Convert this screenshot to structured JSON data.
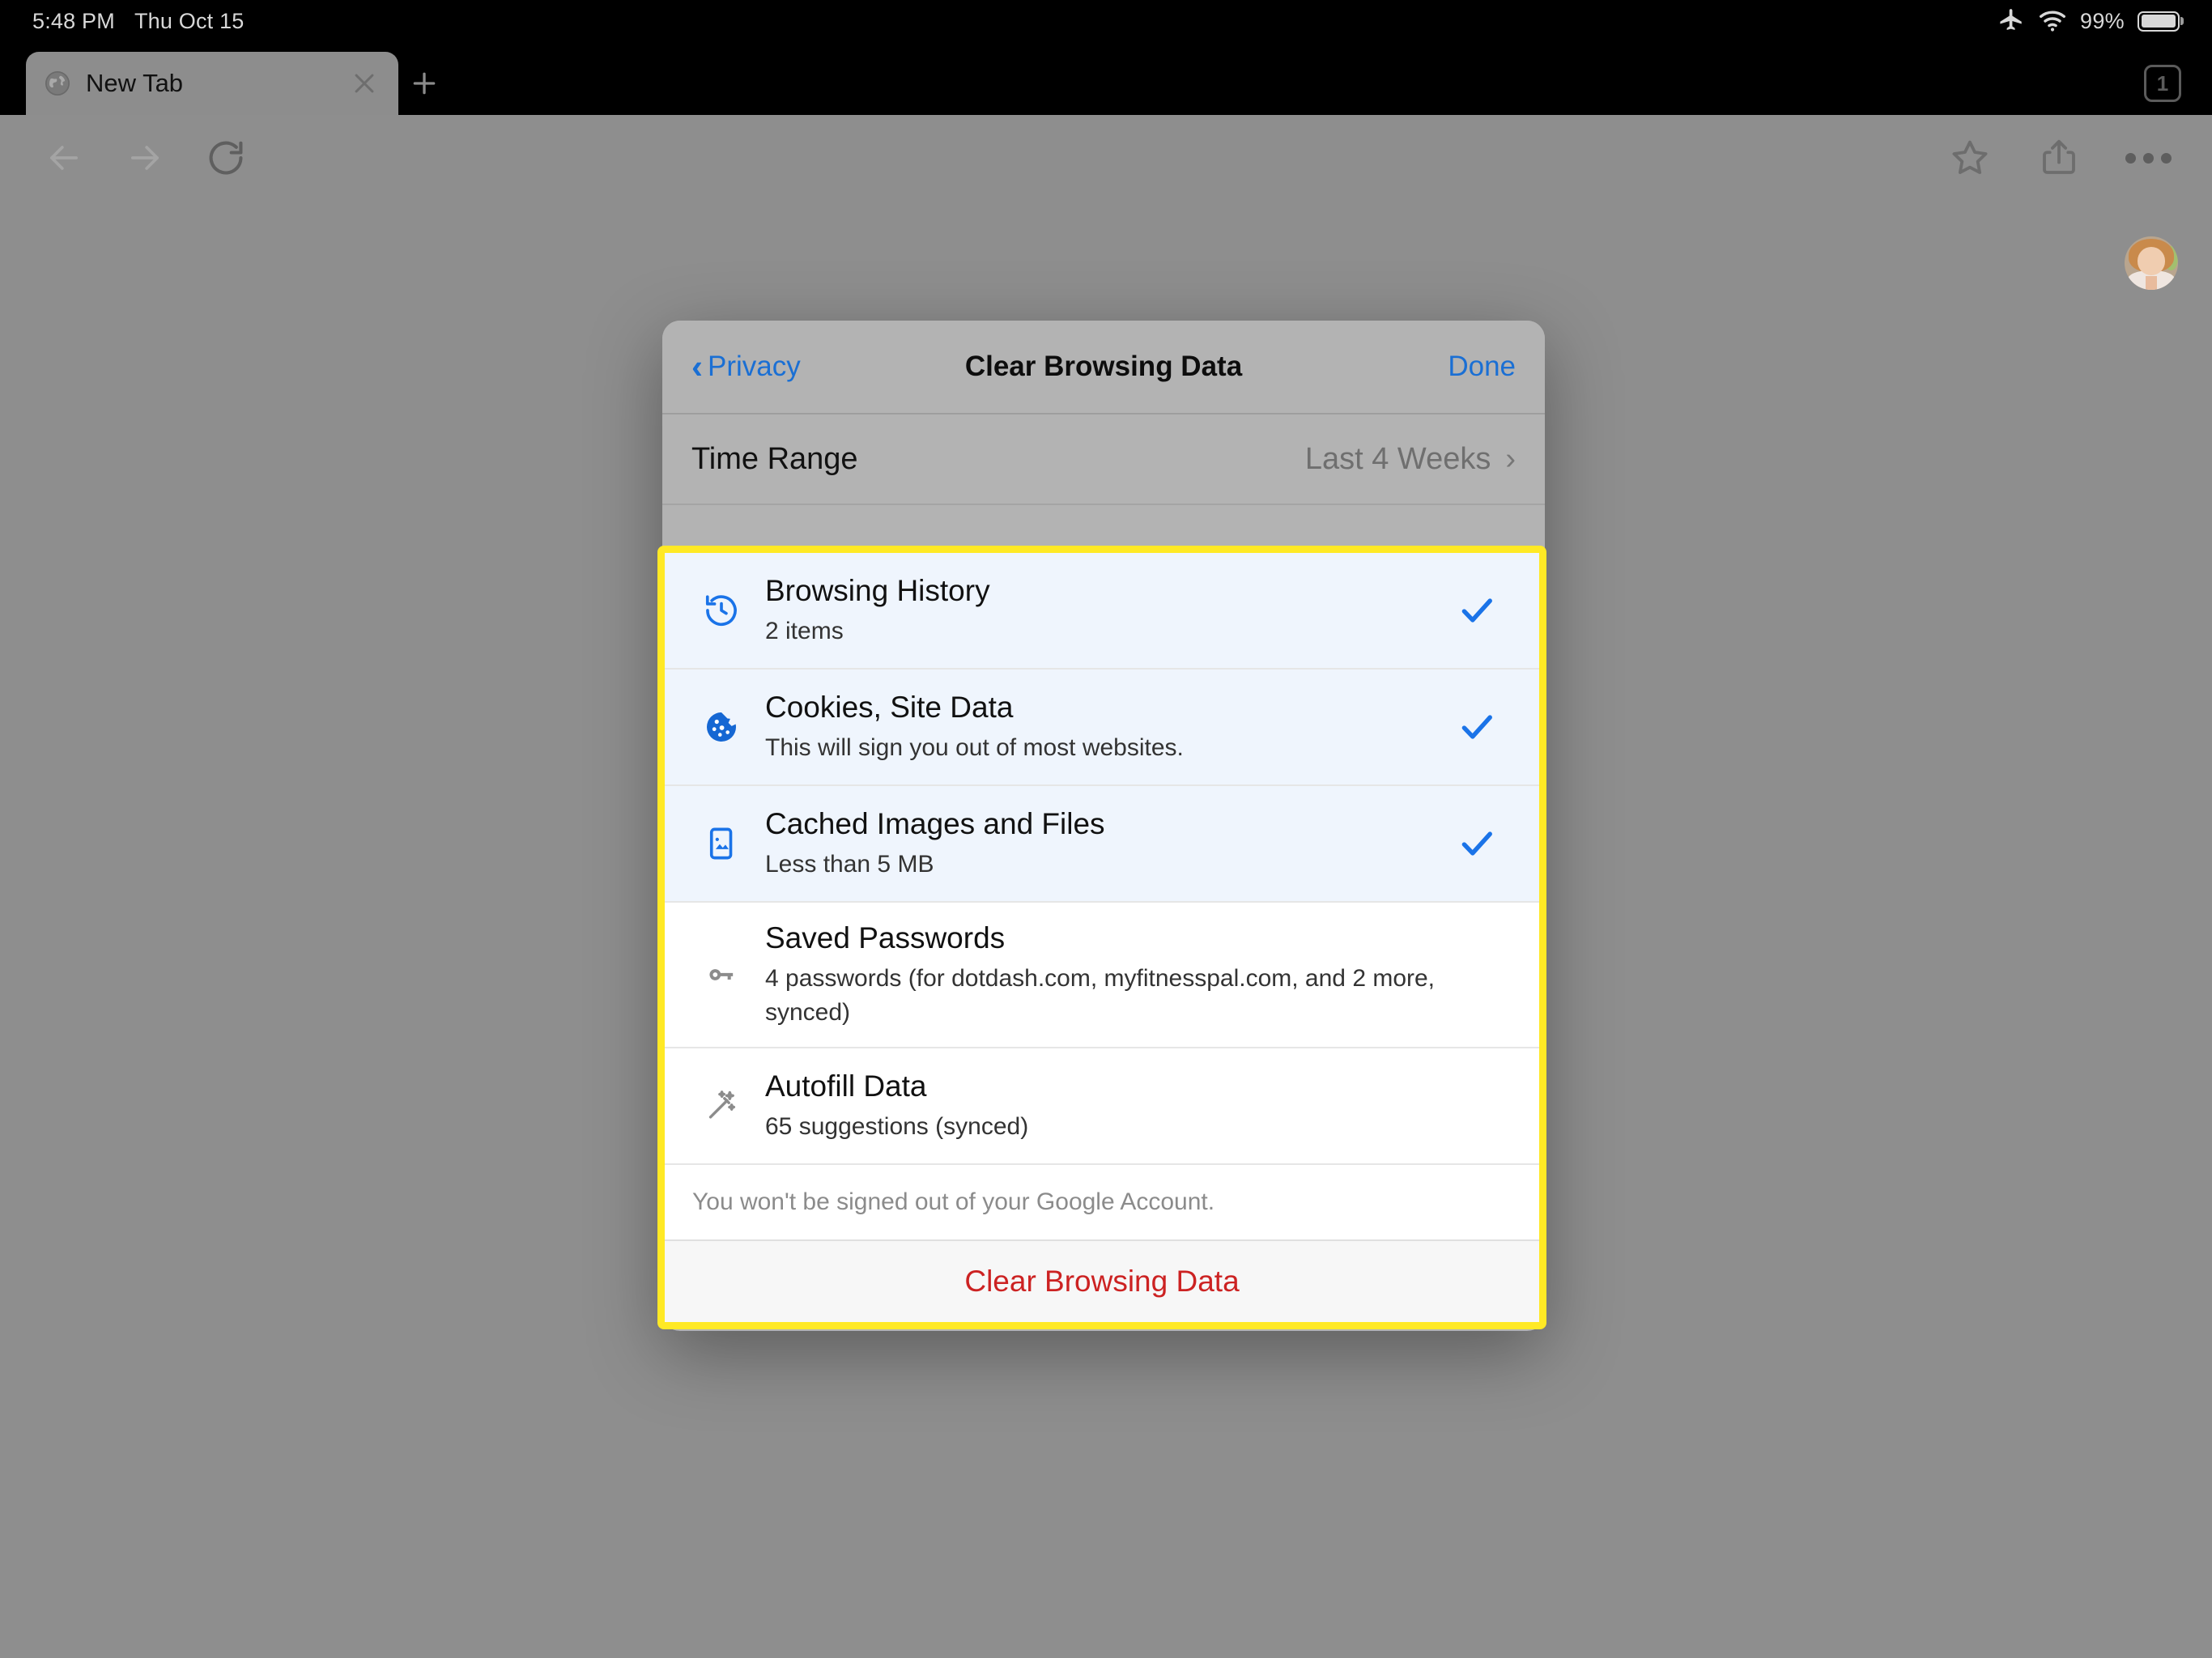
{
  "status_bar": {
    "time": "5:48 PM",
    "date": "Thu Oct 15",
    "airplane_icon": "airplane-icon",
    "wifi_icon": "wifi-icon",
    "battery_percent": "99%",
    "battery_icon": "battery-icon"
  },
  "tab_strip": {
    "tabs": [
      {
        "title": "New Tab",
        "favicon": "globe-icon",
        "close_icon": "close-icon"
      }
    ],
    "new_tab_icon": "plus-icon",
    "tab_count": "1"
  },
  "toolbar": {
    "back_icon": "arrow-left-icon",
    "forward_icon": "arrow-right-icon",
    "reload_icon": "reload-icon",
    "bookmark_icon": "star-icon",
    "share_icon": "share-icon",
    "menu_icon": "more-horizontal-icon"
  },
  "page": {
    "avatar_name": "profile-avatar"
  },
  "modal": {
    "back_label": "Privacy",
    "back_icon": "chevron-left-icon",
    "title": "Clear Browsing Data",
    "done_label": "Done",
    "time_range": {
      "label": "Time Range",
      "value": "Last 4 Weeks",
      "chevron": "chevron-right-icon"
    },
    "items": [
      {
        "icon": "history-clock-icon",
        "title": "Browsing History",
        "subtitle": "2 items",
        "checked": true
      },
      {
        "icon": "cookie-icon",
        "title": "Cookies, Site Data",
        "subtitle": "This will sign you out of most websites.",
        "checked": true
      },
      {
        "icon": "cached-images-icon",
        "title": "Cached Images and Files",
        "subtitle": "Less than 5 MB",
        "checked": true
      },
      {
        "icon": "key-icon",
        "title": "Saved Passwords",
        "subtitle": "4 passwords (for dotdash.com, myfitnesspal.com, and 2 more, synced)",
        "checked": false
      },
      {
        "icon": "magic-wand-icon",
        "title": "Autofill Data",
        "subtitle": "65 suggestions (synced)",
        "checked": false
      }
    ],
    "footnote": "You won't be signed out of your Google Account.",
    "clear_button_label": "Clear Browsing Data"
  },
  "colors": {
    "accent_blue": "#1a6fd4",
    "check_blue": "#1a73e8",
    "destructive_red": "#cc2222",
    "highlight_yellow": "#ffe925",
    "selected_row_bg": "#eff5fd",
    "dimmed_page": "#8e8e8e"
  }
}
